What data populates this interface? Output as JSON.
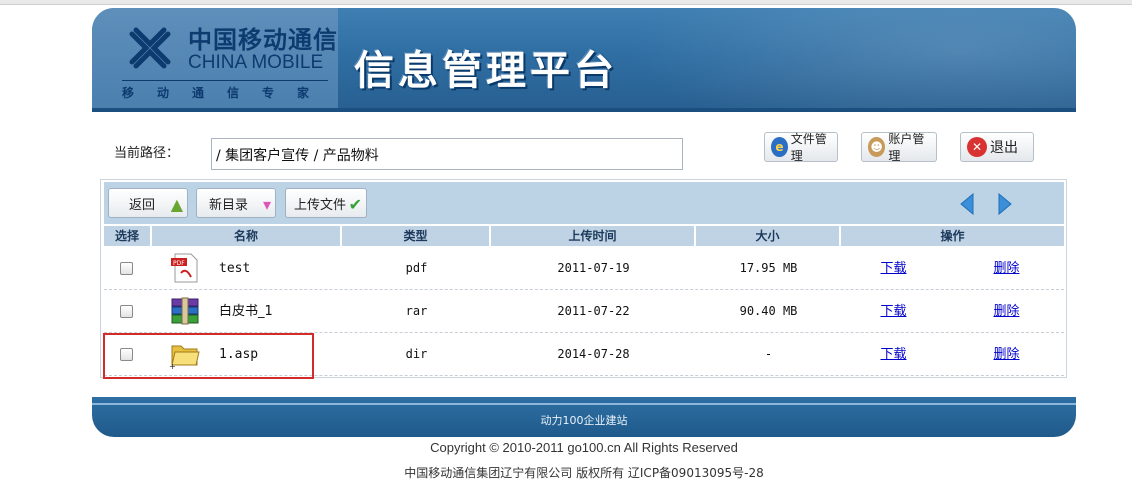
{
  "header": {
    "logo_cn": "中国移动通信",
    "logo_en": "CHINA MOBILE",
    "logo_sub": "移动通信专家",
    "platform_title": "信息管理平台"
  },
  "path": {
    "label": "当前路径：",
    "value": "/ 集团客户宣传 / 产品物料"
  },
  "top_buttons": {
    "files": "文件管理",
    "accounts": "账户管理",
    "logout": "退出"
  },
  "toolbar": {
    "back": "返回",
    "new_dir": "新目录",
    "upload": "上传文件"
  },
  "table": {
    "headers": [
      "选择",
      "名称",
      "类型",
      "上传时间",
      "大小",
      "操作"
    ],
    "rows": [
      {
        "name": "test",
        "type": "pdf",
        "date": "2011-07-19",
        "size": "17.95 MB",
        "download": "下载",
        "delete": "删除",
        "icon": "pdf-icon"
      },
      {
        "name": "白皮书_1",
        "type": "rar",
        "date": "2011-07-22",
        "size": "90.40 MB",
        "download": "下载",
        "delete": "删除",
        "icon": "archive-icon"
      },
      {
        "name": "1.asp",
        "type": "dir",
        "date": "2014-07-28",
        "size": "-",
        "download": "下载",
        "delete": "删除",
        "icon": "folder-icon"
      }
    ]
  },
  "footer": {
    "bar_text": "动力100企业建站",
    "copyright": "Copyright © 2010-2011 go100.cn All Rights Reserved",
    "company": "中国移动通信集团辽宁有限公司  版权所有  辽ICP备09013095号-28"
  },
  "colors": {
    "header_blue": "#2f6ea3",
    "table_header": "#bfd3e4",
    "link": "#0000cc",
    "highlight": "#d22b2b"
  }
}
